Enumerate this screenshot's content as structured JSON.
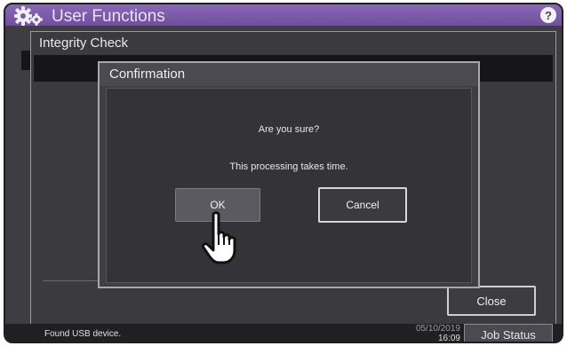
{
  "window": {
    "title": "User Functions",
    "help_glyph": "?",
    "icons": [
      "gear-icon",
      "help-icon"
    ],
    "accent_color": "#7a5aa9"
  },
  "panel": {
    "title": "Integrity Check",
    "close_label": "Close"
  },
  "dialog": {
    "title": "Confirmation",
    "message_1": "Are you sure?",
    "message_2": "This processing takes time.",
    "ok_label": "OK",
    "cancel_label": "Cancel"
  },
  "status_bar": {
    "message": "Found USB device.",
    "date": "05/10/2019",
    "time": "16:09",
    "job_status_label": "Job Status"
  },
  "pointer": {
    "icon": "hand-pointer-icon"
  }
}
